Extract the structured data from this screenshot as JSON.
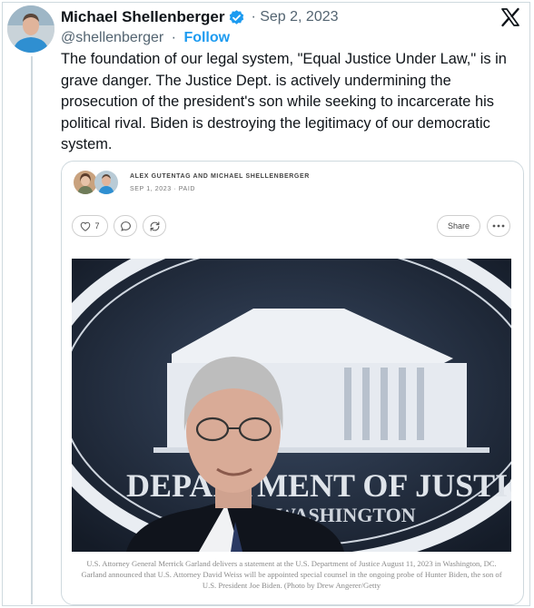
{
  "tweet": {
    "author_name": "Michael Shellenberger",
    "verified_icon": "verified-badge-icon",
    "date": "· Sep 2, 2023",
    "handle": "@shellenberger",
    "separator": "·",
    "follow_label": "Follow",
    "platform_icon": "x-logo-icon",
    "text": "The foundation of our legal system, \"Equal Justice Under Law,\" is in grave danger. The Justice Dept. is actively undermining the prosecution of the president's son while seeking to incarcerate his political rival. Biden is destroying the legitimacy of our democratic system."
  },
  "embed": {
    "authors": "ALEX GUTENTAG AND MICHAEL SHELLENBERGER",
    "meta": "SEP 1, 2023 · PAID",
    "like_count": "7",
    "like_icon": "heart-icon",
    "comment_icon": "comment-icon",
    "restack_icon": "restack-icon",
    "share_label": "Share",
    "more_icon": "more-icon",
    "photo_text_line1": "DEPARTMENT OF JUSTICE",
    "photo_text_line2": "WASHINGTON",
    "caption": "U.S. Attorney General Merrick Garland delivers a statement at the U.S. Department of Justice August 11, 2023 in Washington, DC. Garland announced that U.S. Attorney David Weiss will be appointed special counsel in the ongoing probe of Hunter Biden, the son of U.S. President Joe Biden. (Photo by Drew Angerer/Getty"
  },
  "colors": {
    "accent": "#1d9bf0",
    "text": "#0f1419",
    "muted": "#536471",
    "border": "#cfd9de"
  }
}
